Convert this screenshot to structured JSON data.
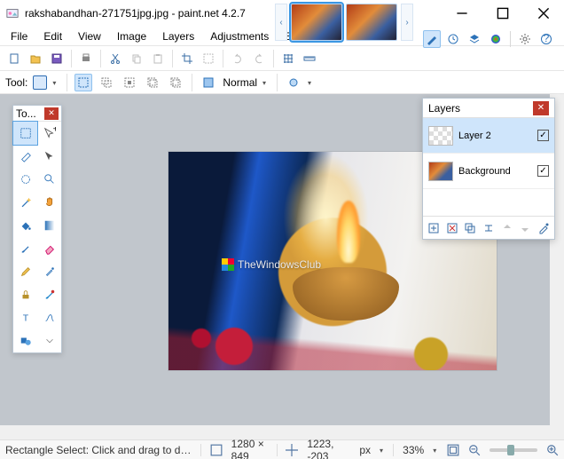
{
  "title": "rakshabandhan-271751jpg.jpg - paint.net 4.2.7",
  "menu": [
    "File",
    "Edit",
    "View",
    "Image",
    "Layers",
    "Adjustments",
    "Effects"
  ],
  "toolopts": {
    "label": "Tool:",
    "blend_label": "Normal"
  },
  "tools_window": {
    "title": "To..."
  },
  "layers_window": {
    "title": "Layers",
    "layers": [
      {
        "name": "Layer 2",
        "visible": true,
        "selected": true
      },
      {
        "name": "Background",
        "visible": true,
        "selected": false
      }
    ]
  },
  "watermark": "TheWindowsClub",
  "status": {
    "hint": "Rectangle Select: Click and drag to draw a rectangular selection. Hol…",
    "image_size": "1280 × 849",
    "cursor_pos": "1223, -203",
    "units": "px",
    "zoom": "33%"
  }
}
